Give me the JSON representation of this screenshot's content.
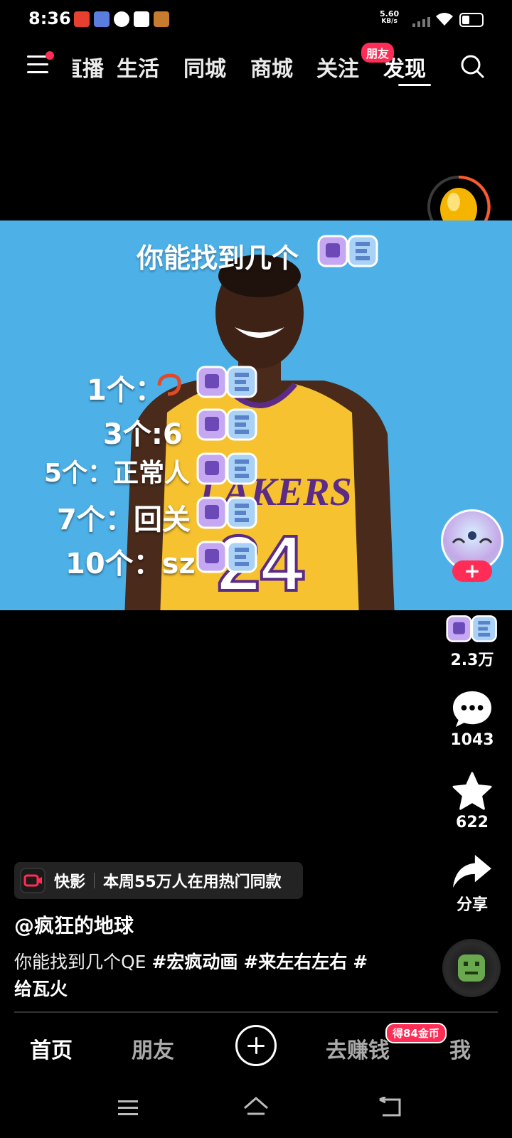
{
  "status_bar": {
    "time": "8:36",
    "net_speed": "5.60",
    "net_unit": "KB/s"
  },
  "top_nav": {
    "tabs": [
      "直播",
      "生活",
      "同城",
      "商城",
      "关注",
      "发现"
    ],
    "active_tab": "发现",
    "friend_badge": "朋友"
  },
  "video": {
    "title": "你能找到几个",
    "lines": [
      "1个：",
      "3个:6",
      "5个：正常人",
      "7个：回关",
      "10个：sz"
    ],
    "jersey_text": "LAKERS",
    "jersey_number": "24"
  },
  "rail": {
    "like_count": "2.3万",
    "comment_count": "1043",
    "favorite_count": "622",
    "share_label": "分享",
    "follow_symbol": "+"
  },
  "caption": {
    "chip_brand": "快影",
    "chip_text": "本周55万人在用热门同款",
    "author": "@疯狂的地球",
    "description": "你能找到几个QE",
    "hashtags": [
      "#宏疯动画",
      "#来左右左右",
      "#给瓦火"
    ]
  },
  "bottom_nav": {
    "home": "首页",
    "friends": "朋友",
    "earn": "去赚钱",
    "me": "我",
    "coin_badge": "得84金币"
  },
  "colors": {
    "accent": "#ff2d55",
    "video_bg": "#4db1e8",
    "jersey": "#f6c230"
  }
}
